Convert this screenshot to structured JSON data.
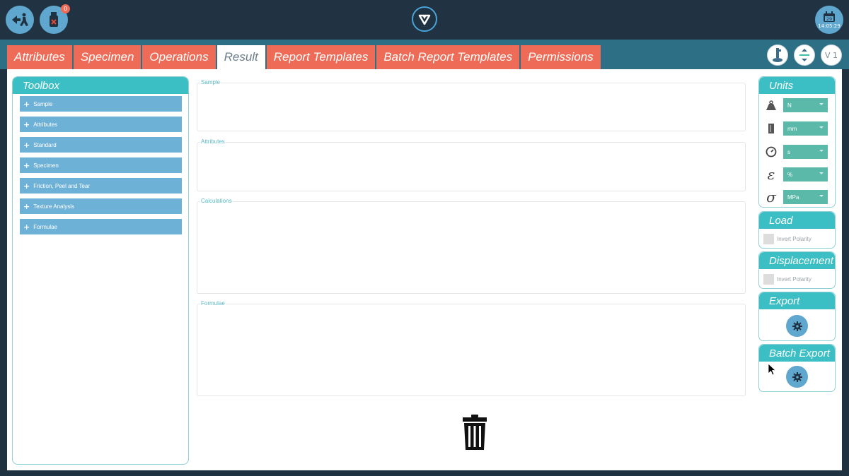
{
  "topbar": {
    "usb_badge": "0",
    "clock": {
      "day": "29",
      "time": "14:05:29"
    }
  },
  "tabs": [
    {
      "label": "Attributes",
      "active": false
    },
    {
      "label": "Specimen",
      "active": false
    },
    {
      "label": "Operations",
      "active": false
    },
    {
      "label": "Result",
      "active": true
    },
    {
      "label": "Report Templates",
      "active": false
    },
    {
      "label": "Batch Report Templates",
      "active": false
    },
    {
      "label": "Permissions",
      "active": false
    }
  ],
  "tools": {
    "version_label": "V 1"
  },
  "toolbox": {
    "title": "Toolbox",
    "items": [
      "Sample",
      "Attributes",
      "Standard",
      "Specimen",
      "Friction, Peel and Tear",
      "Texture Analysis",
      "Formulae"
    ]
  },
  "sections": {
    "sample": "Sample",
    "attributes": "Attributes",
    "calculations": "Calculations",
    "formulae": "Formulae"
  },
  "units": {
    "title": "Units",
    "rows": [
      {
        "icon": "weight-icon",
        "value": "N"
      },
      {
        "icon": "length-icon",
        "value": "mm"
      },
      {
        "icon": "time-icon",
        "value": "s"
      },
      {
        "icon": "strain-icon",
        "value": "%"
      },
      {
        "icon": "stress-icon",
        "value": "MPa"
      }
    ]
  },
  "load": {
    "title": "Load",
    "checkbox_label": "Invert Polarity"
  },
  "displacement": {
    "title": "Displacement",
    "checkbox_label": "Invert Polarity"
  },
  "export": {
    "title": "Export"
  },
  "batch_export": {
    "title": "Batch Export"
  },
  "colors": {
    "topbar": "#213343",
    "tab": "#ee6b57",
    "panel_header": "#3cbfc4",
    "toolbox_item": "#6eb1d6",
    "unit_select": "#5ab9a8",
    "circle_button": "#5fa7cf"
  }
}
